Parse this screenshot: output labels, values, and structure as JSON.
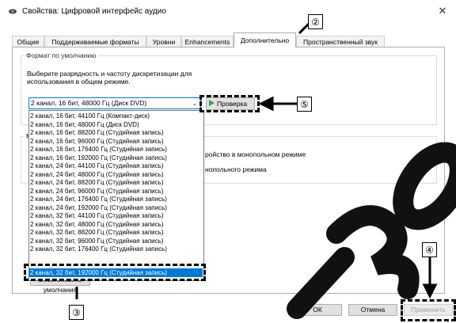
{
  "window": {
    "title": "Свойства: Цифровой интерфейс аудио",
    "close_label": "✕"
  },
  "tabs": [
    {
      "label": "Общие"
    },
    {
      "label": "Поддерживаемые форматы"
    },
    {
      "label": "Уровни"
    },
    {
      "label": "Enhancements"
    },
    {
      "label": "Дополнительно",
      "active": true
    },
    {
      "label": "Пространственный звук"
    }
  ],
  "default_format": {
    "group_title": "Формат по умолчанию",
    "description": "Выберите разрядность и частоту дискретизации для использования в общем режиме.",
    "selected_value": "2 канал, 16 бит, 48000 Гц (Диск DVD)",
    "test_button_label": "Проверка",
    "options": [
      "2 канал, 16 бит, 44100 Гц (Компакт-диск)",
      "2 канал, 16 бит, 48000 Гц (Диск DVD)",
      "2 канал, 16 бит, 88200 Гц (Студийная запись)",
      "2 канал, 16 бит, 96000 Гц (Студийная запись)",
      "2 канал, 16 бит, 176400 Гц (Студийная запись)",
      "2 канал, 16 бит, 192000 Гц (Студийная запись)",
      "2 канал, 24 бит, 44100 Гц (Студийная запись)",
      "2 канал, 24 бит, 48000 Гц (Студийная запись)",
      "2 канал, 24 бит, 88200 Гц (Студийная запись)",
      "2 канал, 24 бит, 96000 Гц (Студийная запись)",
      "2 канал, 24 бит, 176400 Гц (Студийная запись)",
      "2 канал, 24 бит, 192000 Гц (Студийная запись)",
      "2 канал, 32 бит, 44100 Гц (Студийная запись)",
      "2 канал, 32 бит, 48000 Гц (Студийная запись)",
      "2 канал, 32 бит, 88200 Гц (Студийная запись)",
      "2 канал, 32 бит, 96000 Гц (Студийная запись)",
      "2 канал, 32 бит, 176400 Гц (Студийная запись)",
      "2 канал, 32 бит, 192000 Гц (Студийная запись)"
    ],
    "highlighted_option": "2 канал, 32 бит, 192000 Гц (Студийная запись)"
  },
  "exclusive_mode": {
    "group_title_visible": "М",
    "checkbox1_visible_text": "ройство в монопольном режиме",
    "checkbox2_visible_text": "нопольного режима"
  },
  "restore_button_label": "Восстановить умолчания",
  "footer": {
    "ok_label": "ОК",
    "cancel_label": "Отмена",
    "apply_label": "Применить"
  },
  "callouts": {
    "c2": "②",
    "c3": "③",
    "c4": "④",
    "c5": "⑤"
  },
  "watermark_text": "130",
  "icons": [
    "speaker-icon",
    "close-icon",
    "chevron-down-icon",
    "play-icon"
  ]
}
